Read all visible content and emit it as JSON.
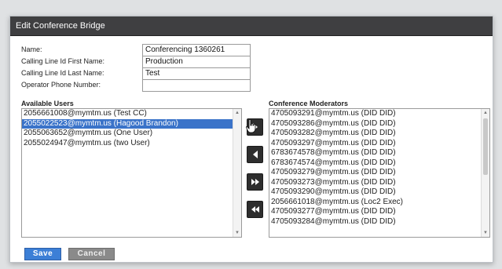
{
  "dialog": {
    "title": "Edit Conference Bridge"
  },
  "form": {
    "fields": [
      {
        "label": "Name:",
        "value": "Conferencing 1360261"
      },
      {
        "label": "Calling Line Id First Name:",
        "value": "Production"
      },
      {
        "label": "Calling Line Id Last Name:",
        "value": "Test"
      },
      {
        "label": "Operator Phone Number:",
        "value": ""
      }
    ]
  },
  "available_users": {
    "label": "Available Users",
    "items": [
      "2056661008@mymtm.us (Test CC)",
      "2055022523@mymtm.us (Hagood Brandon)",
      "2055063652@mymtm.us (One User)",
      "2055024947@mymtm.us (two User)"
    ],
    "selected_index": 1
  },
  "conference_moderators": {
    "label": "Conference Moderators",
    "items": [
      "4705093291@mymtm.us (DID DID)",
      "4705093286@mymtm.us (DID DID)",
      "4705093282@mymtm.us (DID DID)",
      "4705093297@mymtm.us (DID DID)",
      "6783674578@mymtm.us (DID DID)",
      "6783674574@mymtm.us (DID DID)",
      "4705093279@mymtm.us (DID DID)",
      "4705093273@mymtm.us (DID DID)",
      "4705093290@mymtm.us (DID DID)",
      "2056661018@mymtm.us (Loc2 Exec)",
      "4705093277@mymtm.us (DID DID)",
      "4705093284@mymtm.us (DID DID)"
    ]
  },
  "move_buttons": [
    {
      "icon": "arrow-right-icon"
    },
    {
      "icon": "arrow-left-icon"
    },
    {
      "icon": "double-arrow-right-icon"
    },
    {
      "icon": "double-arrow-left-icon"
    }
  ],
  "actions": {
    "save_label": "Save",
    "cancel_label": "Cancel"
  },
  "colors": {
    "titlebar": "#3f3f41",
    "selection": "#3a73c9",
    "save_button": "#3c7fd6",
    "cancel_button": "#8a8a8a"
  }
}
